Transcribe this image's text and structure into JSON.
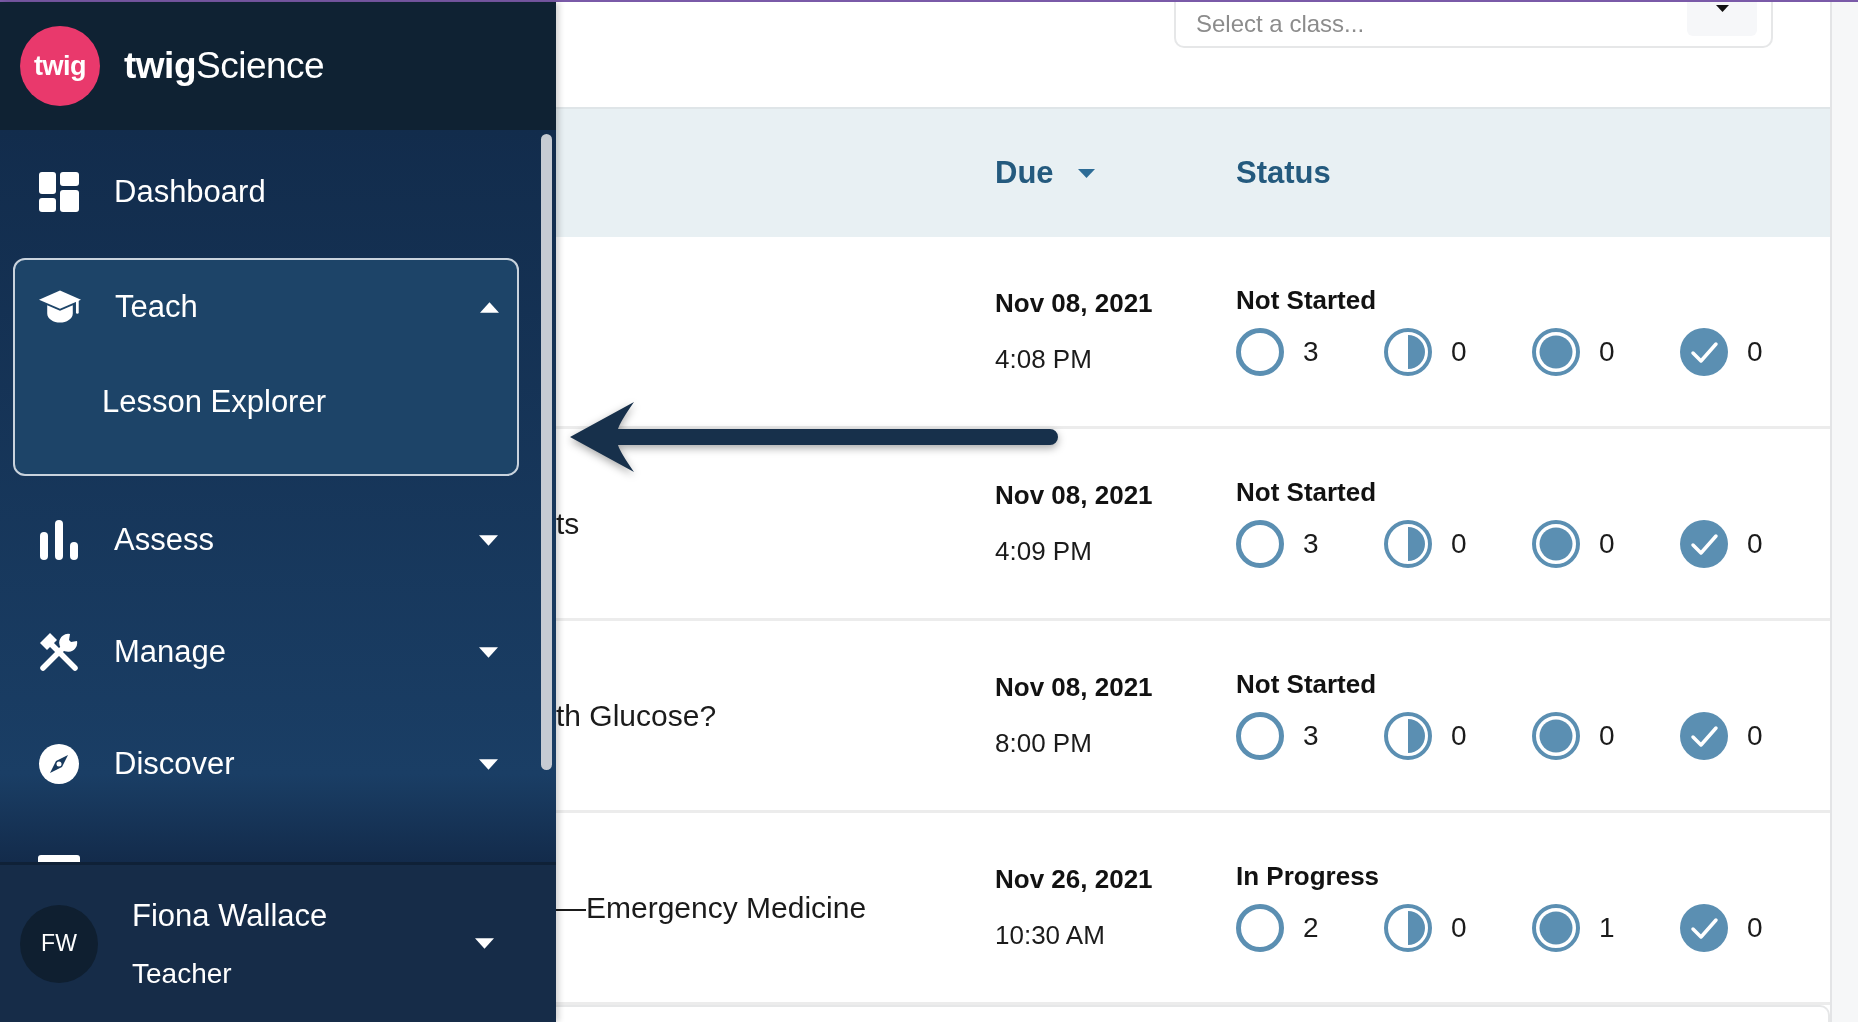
{
  "brand": {
    "badge": "twig",
    "name": "**twig**Science"
  },
  "nav": {
    "items": [
      {
        "label": "Dashboard",
        "kind": "link"
      },
      {
        "label": "Teach",
        "kind": "group",
        "expanded": true,
        "children": [
          {
            "label": "Lesson Explorer"
          }
        ]
      },
      {
        "label": "Assess",
        "kind": "group",
        "expanded": false
      },
      {
        "label": "Manage",
        "kind": "group",
        "expanded": false
      },
      {
        "label": "Discover",
        "kind": "group",
        "expanded": false
      }
    ]
  },
  "user": {
    "initials": "FW",
    "name": "Fiona Wallace",
    "role": "Teacher",
    "expanded": false
  },
  "class_select": {
    "placeholder": "Select a class..."
  },
  "table": {
    "columns": [
      {
        "label": "Due",
        "sorted": true
      },
      {
        "label": "Status",
        "sorted": false
      }
    ],
    "rows": [
      {
        "due_date": "Nov 08, 2021",
        "due_time": "4:08 PM",
        "status": "Not Started",
        "counts": [
          {
            "kind": "open",
            "value": "3"
          },
          {
            "kind": "half",
            "value": "0"
          },
          {
            "kind": "ring",
            "value": "0"
          },
          {
            "kind": "check",
            "value": "0"
          }
        ]
      },
      {
        "title": "ts",
        "due_date": "Nov 08, 2021",
        "due_time": "4:09 PM",
        "status": "Not Started",
        "counts": [
          {
            "kind": "open",
            "value": "3"
          },
          {
            "kind": "half",
            "value": "0"
          },
          {
            "kind": "ring",
            "value": "0"
          },
          {
            "kind": "check",
            "value": "0"
          }
        ]
      },
      {
        "title": "th Glucose?",
        "due_date": "Nov 08, 2021",
        "due_time": "8:00 PM",
        "status": "Not Started",
        "counts": [
          {
            "kind": "open",
            "value": "3"
          },
          {
            "kind": "half",
            "value": "0"
          },
          {
            "kind": "ring",
            "value": "0"
          },
          {
            "kind": "check",
            "value": "0"
          }
        ]
      },
      {
        "title": "—Emergency Medicine",
        "due_date": "Nov 26, 2021",
        "due_time": "10:30 AM",
        "status": "In Progress",
        "counts": [
          {
            "kind": "open",
            "value": "2"
          },
          {
            "kind": "half",
            "value": "0"
          },
          {
            "kind": "ring",
            "value": "1"
          },
          {
            "kind": "check",
            "value": "0"
          }
        ]
      }
    ]
  }
}
